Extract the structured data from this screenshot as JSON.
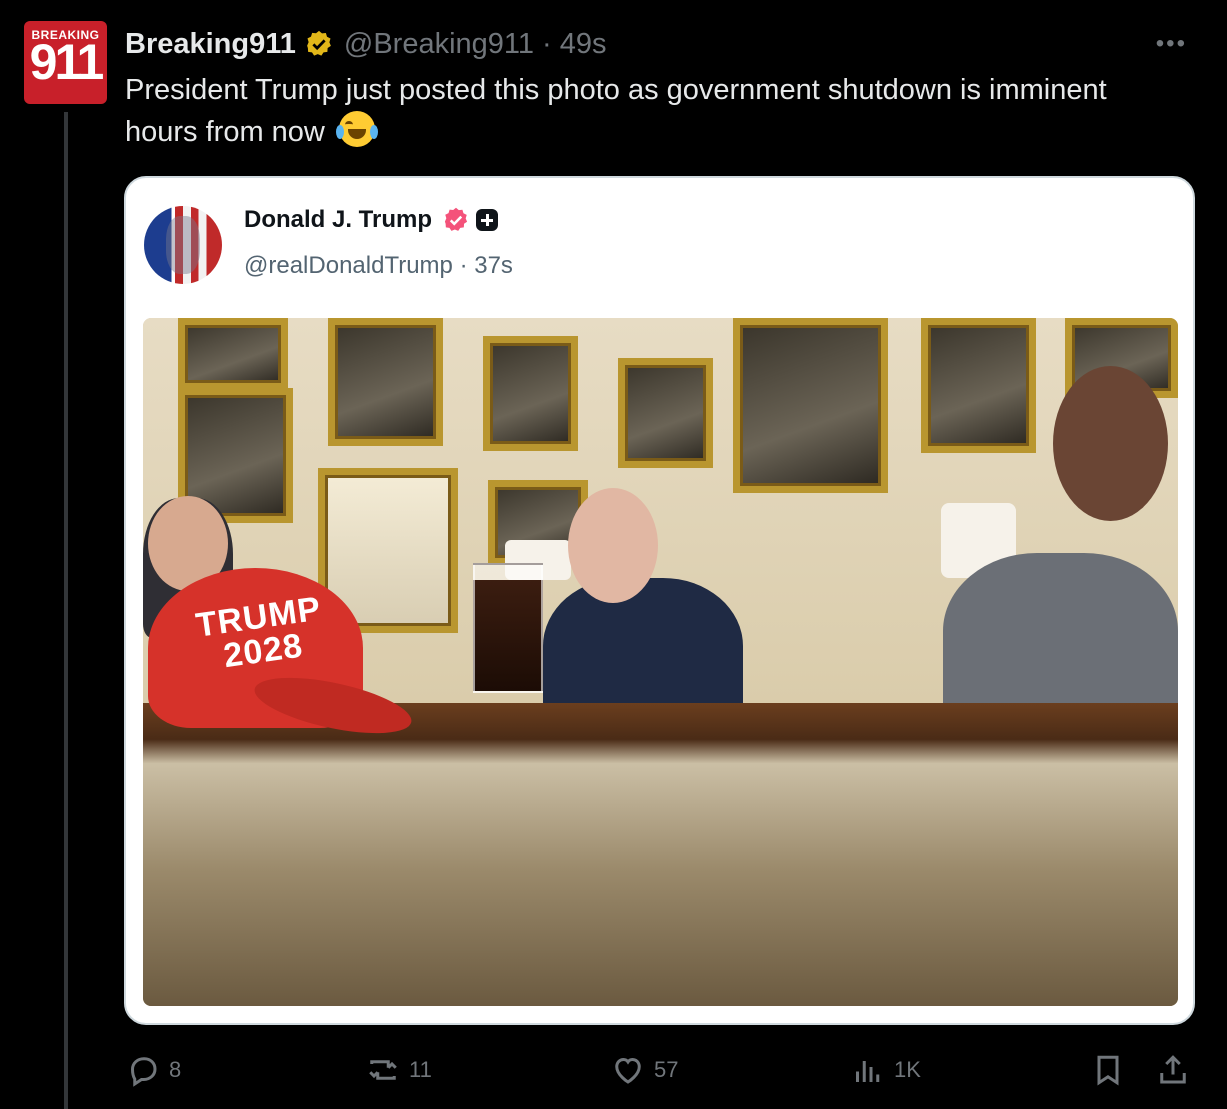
{
  "tweet": {
    "avatar_text": {
      "top": "BREAKING",
      "number": "911"
    },
    "display_name": "Breaking911",
    "handle": "@Breaking911",
    "separator": "·",
    "time": "49s",
    "text": "President Trump just posted this photo as government shutdown is imminent hours from now",
    "emoji": "face-with-tears-of-joy"
  },
  "quoted": {
    "display_name": "Donald J. Trump",
    "handle": "@realDonaldTrump",
    "separator": "·",
    "time": "37s",
    "photo": {
      "hat_text_line1": "TRUMP",
      "hat_text_line2": "2028"
    }
  },
  "actions": {
    "replies": "8",
    "reposts": "11",
    "likes": "57",
    "views": "1K"
  },
  "colors": {
    "background": "#000000",
    "verified_gold": "#e2b719",
    "pink_verified": "#f4527a",
    "muted_text": "#71767b"
  }
}
